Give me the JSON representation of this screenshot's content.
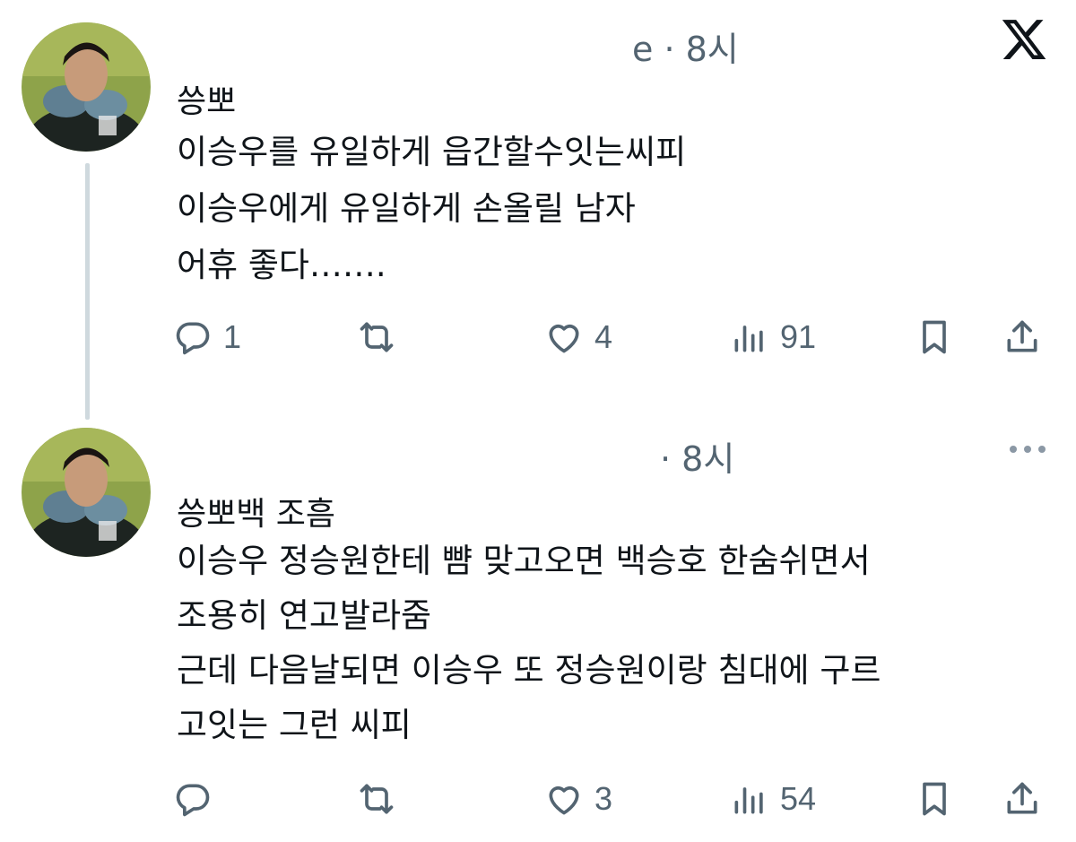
{
  "brand": {
    "logo_icon": "x-logo-icon"
  },
  "colors": {
    "text": "#0f1419",
    "secondary": "#536471",
    "thread_line": "#cfd9de"
  },
  "tweets": [
    {
      "author": "씅뽀",
      "meta": "e · 8시",
      "lines": [
        "이승우를 유일하게 읍간할수잇는씨피",
        "이승우에게 유일하게 손올릴 남자",
        "어휴 좋다……."
      ],
      "actions": {
        "reply": {
          "icon": "reply-icon",
          "count": "1"
        },
        "retweet": {
          "icon": "retweet-icon",
          "count": ""
        },
        "like": {
          "icon": "heart-icon",
          "count": "4"
        },
        "views": {
          "icon": "views-icon",
          "count": "91"
        },
        "bookmark": {
          "icon": "bookmark-icon"
        },
        "share": {
          "icon": "share-icon"
        }
      }
    },
    {
      "author": "씅뽀백 조흠",
      "meta": "· 8시",
      "lines": [
        "이승우 정승원한테 뺨 맞고오면 백승호 한숨쉬면서",
        "조용히 연고발라줌",
        "근데 다음날되면 이승우 또 정승원이랑 침대에 구르",
        "고잇는 그런 씨피"
      ],
      "actions": {
        "reply": {
          "icon": "reply-icon",
          "count": ""
        },
        "retweet": {
          "icon": "retweet-icon",
          "count": ""
        },
        "like": {
          "icon": "heart-icon",
          "count": "3"
        },
        "views": {
          "icon": "views-icon",
          "count": "54"
        },
        "bookmark": {
          "icon": "bookmark-icon"
        },
        "share": {
          "icon": "share-icon"
        }
      }
    }
  ]
}
